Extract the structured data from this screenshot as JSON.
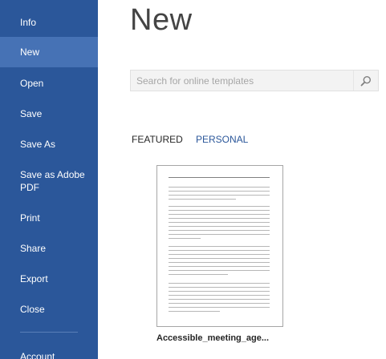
{
  "sidebar": {
    "items": [
      {
        "label": "Info"
      },
      {
        "label": "New"
      },
      {
        "label": "Open"
      },
      {
        "label": "Save"
      },
      {
        "label": "Save As"
      },
      {
        "label": "Save as Adobe PDF"
      },
      {
        "label": "Print"
      },
      {
        "label": "Share"
      },
      {
        "label": "Export"
      },
      {
        "label": "Close"
      },
      {
        "label": "Account"
      }
    ],
    "active_item": "New",
    "colors": {
      "background": "#2b579a",
      "active": "#4672b5"
    }
  },
  "main": {
    "title": "New",
    "search": {
      "placeholder": "Search for online templates",
      "value": "",
      "icon": "search-icon"
    },
    "tabs": [
      {
        "label": "FEATURED"
      },
      {
        "label": "PERSONAL"
      }
    ],
    "templates": [
      {
        "name": "Accessible_meeting_age..."
      }
    ]
  }
}
